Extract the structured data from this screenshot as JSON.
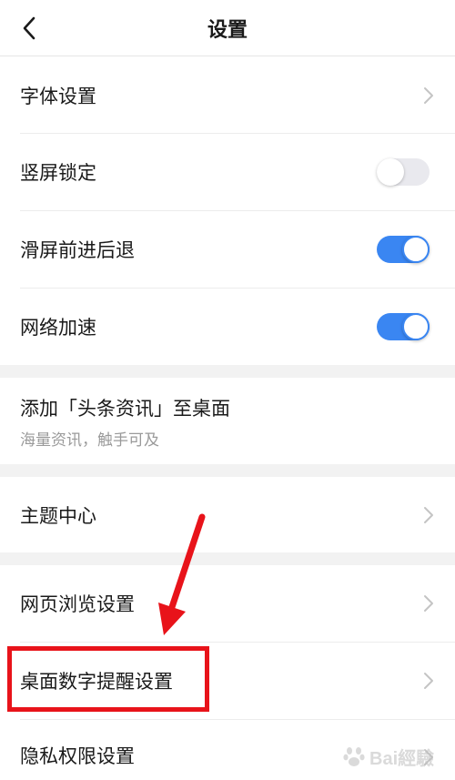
{
  "header": {
    "title": "设置",
    "back_icon": "chevron-left-icon"
  },
  "rows": {
    "font": {
      "label": "字体设置"
    },
    "lock": {
      "label": "竖屏锁定",
      "toggle": "off"
    },
    "swipe": {
      "label": "滑屏前进后退",
      "toggle": "on"
    },
    "net": {
      "label": "网络加速",
      "toggle": "on"
    },
    "desktop": {
      "label": "添加「头条资讯」至桌面",
      "sub": "海量资讯，触手可及"
    },
    "theme": {
      "label": "主题中心"
    },
    "web": {
      "label": "网页浏览设置"
    },
    "badge": {
      "label": "桌面数字提醒设置"
    },
    "privacy": {
      "label": "隐私权限设置"
    }
  },
  "colors": {
    "accent": "#3a86f2",
    "highlight": "#e8131a",
    "section_gap": "#f2f2f2"
  },
  "watermark": {
    "text": "Bai經驗"
  }
}
